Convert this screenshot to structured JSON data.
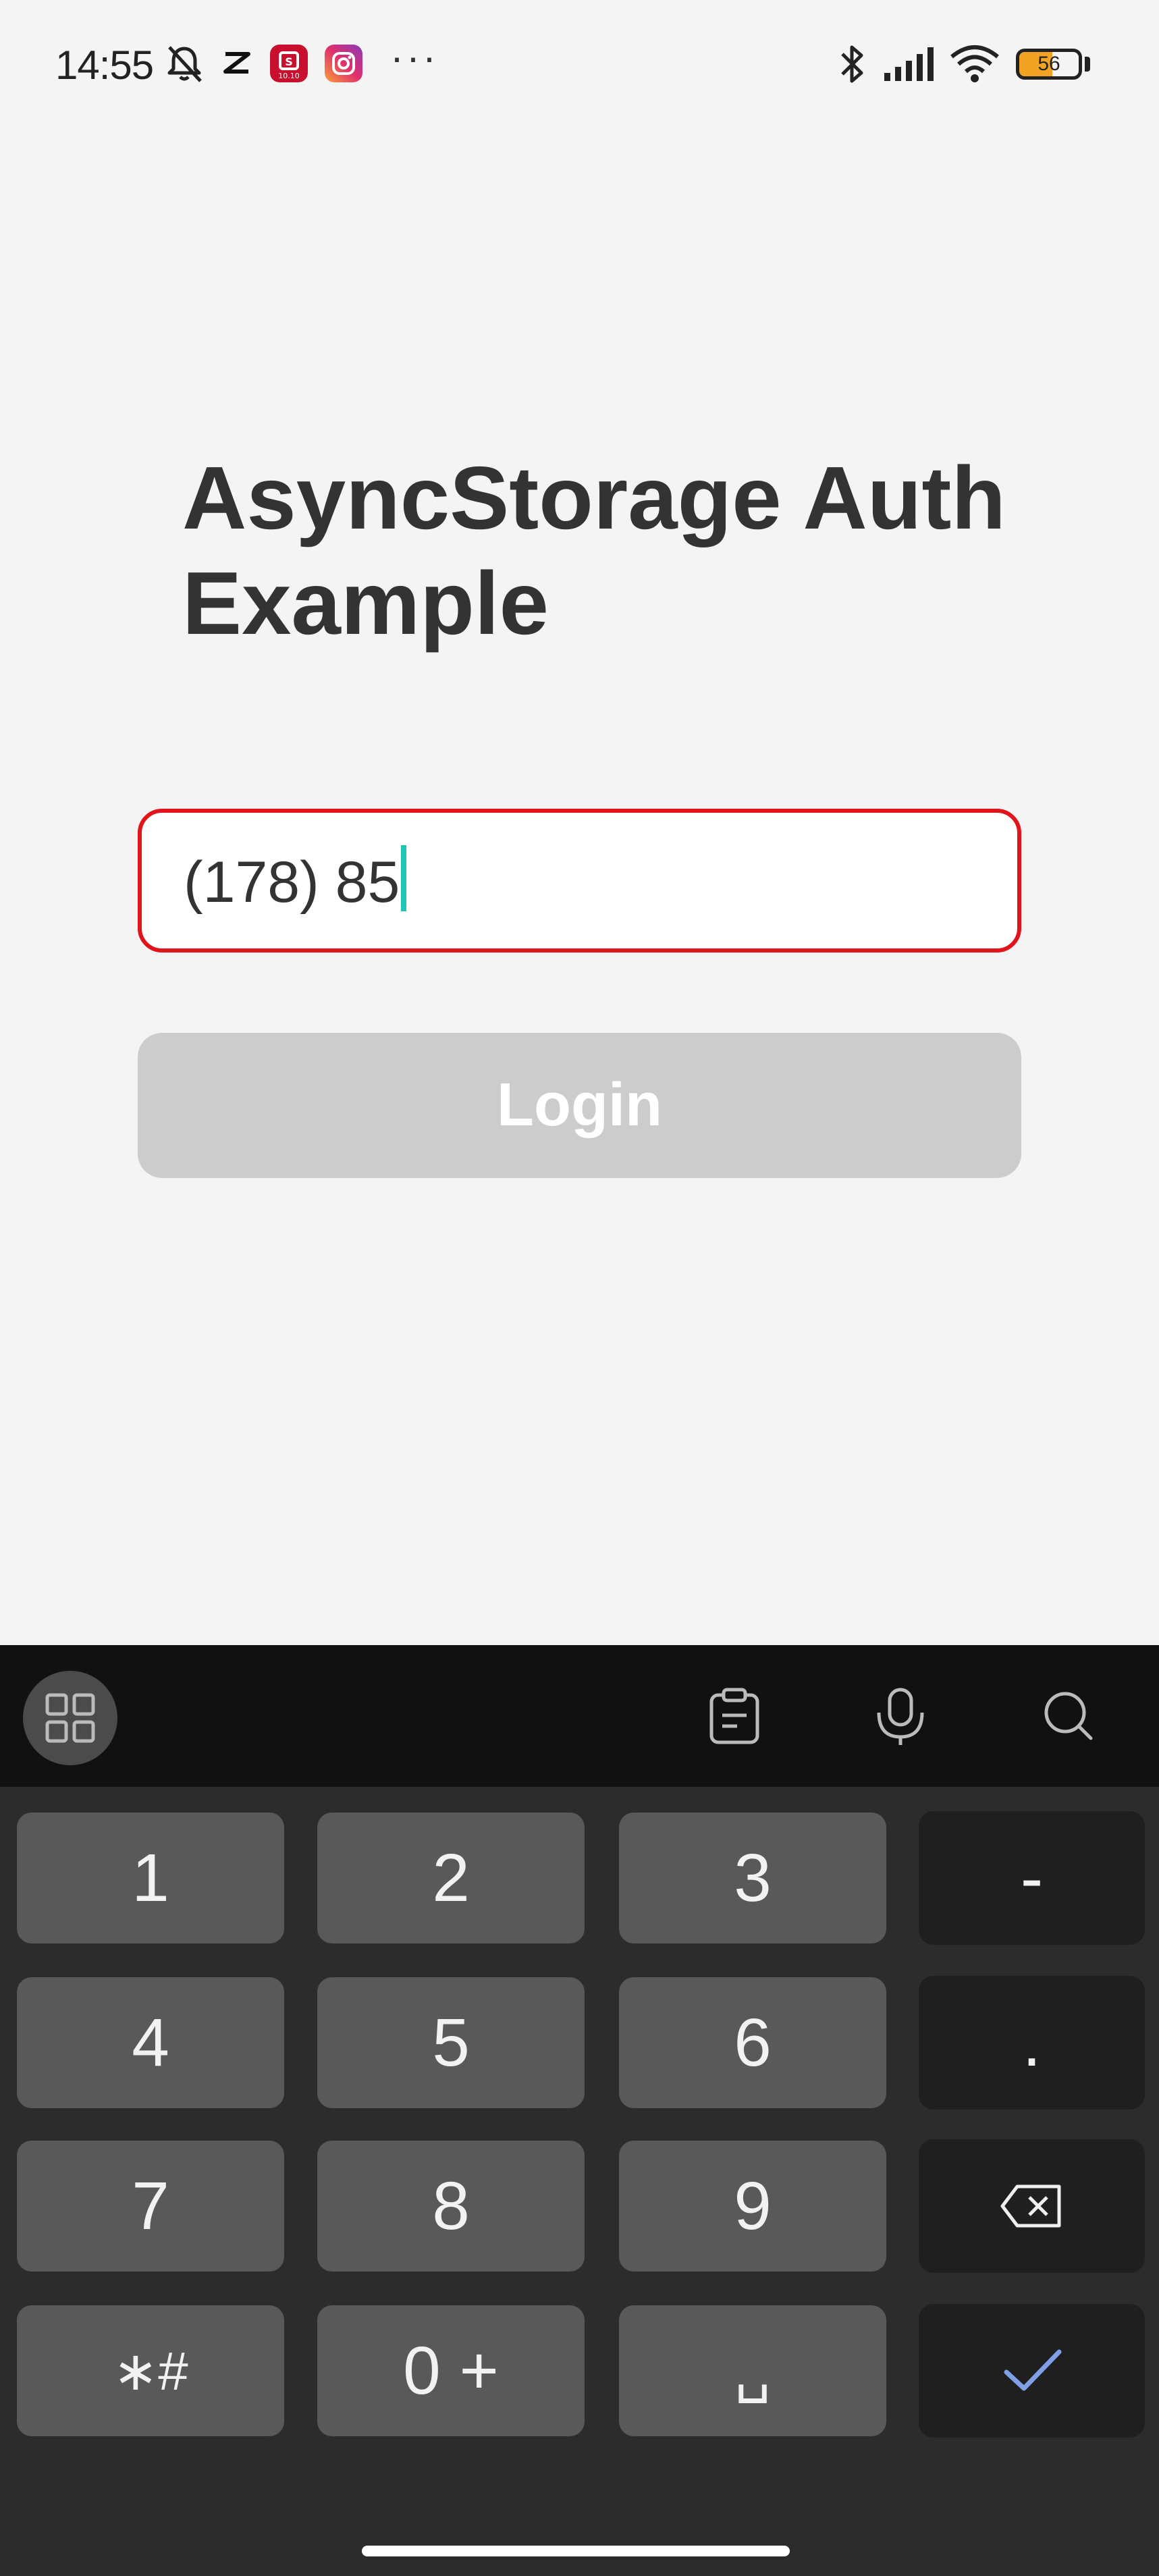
{
  "status_bar": {
    "time": "14:55",
    "battery_percent": "56",
    "battery_level": 0.56,
    "icons": [
      "mute-icon",
      "capcut-icon",
      "shopee-icon",
      "instagram-icon",
      "more-dots-icon",
      "bluetooth-icon",
      "signal-icon",
      "wifi-icon",
      "battery-icon"
    ],
    "more_label": "···"
  },
  "app": {
    "title": "AsyncStorage Auth Example",
    "phone_input": {
      "value": "(178) 85"
    },
    "login_button": {
      "label": "Login",
      "enabled": false
    }
  },
  "keyboard": {
    "toolbar": [
      "apps-grid-icon",
      "clipboard-icon",
      "microphone-icon",
      "search-icon"
    ],
    "keys": {
      "k1": "1",
      "k2": "2",
      "k3": "3",
      "dash": "-",
      "k4": "4",
      "k5": "5",
      "k6": "6",
      "dot": ".",
      "k7": "7",
      "k8": "8",
      "k9": "9",
      "symbols": "∗#",
      "k0": "0 +",
      "space": "␣"
    },
    "special_keys": [
      "backspace-icon",
      "done-check-icon"
    ]
  },
  "colors": {
    "background": "#f4f4f4",
    "input_border_error": "#e0141a",
    "caret": "#1fc6b2",
    "button_disabled": "#cccccc",
    "keyboard_bg": "#2c2c2c",
    "key_bg": "#595959",
    "function_key_bg": "#1f1f1f",
    "confirm_accent": "#7f9fe6"
  }
}
